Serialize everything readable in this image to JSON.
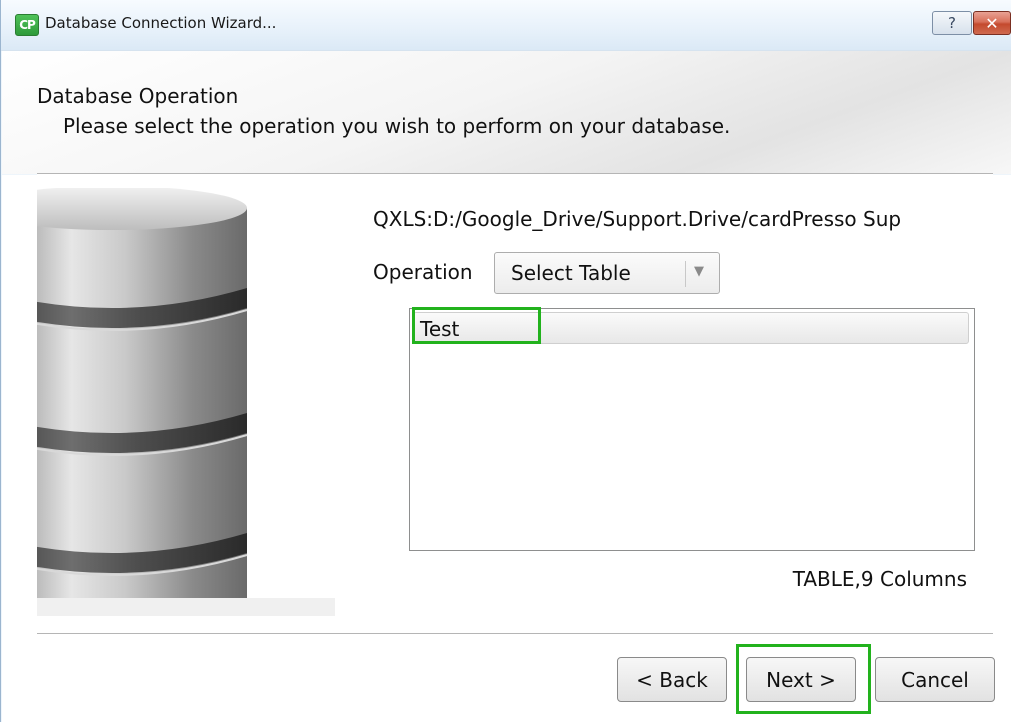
{
  "window": {
    "title": "Database Connection Wizard...",
    "app_icon_text": "CP",
    "help_glyph": "?",
    "close_glyph": "✕"
  },
  "header": {
    "title": "Database Operation",
    "subtitle": "Please select the operation you wish to perform on your database."
  },
  "source": {
    "path": "QXLS:D:/Google_Drive/Support.Drive/cardPresso Sup"
  },
  "operation": {
    "label": "Operation",
    "selected": "Select Table"
  },
  "tables": {
    "items": [
      "Test"
    ],
    "selected_index": 0,
    "info": "TABLE,9 Columns"
  },
  "buttons": {
    "back": "< Back",
    "next": "Next >",
    "cancel": "Cancel"
  },
  "colors": {
    "highlight": "#22b21d",
    "close_button": "#c44a2e"
  }
}
